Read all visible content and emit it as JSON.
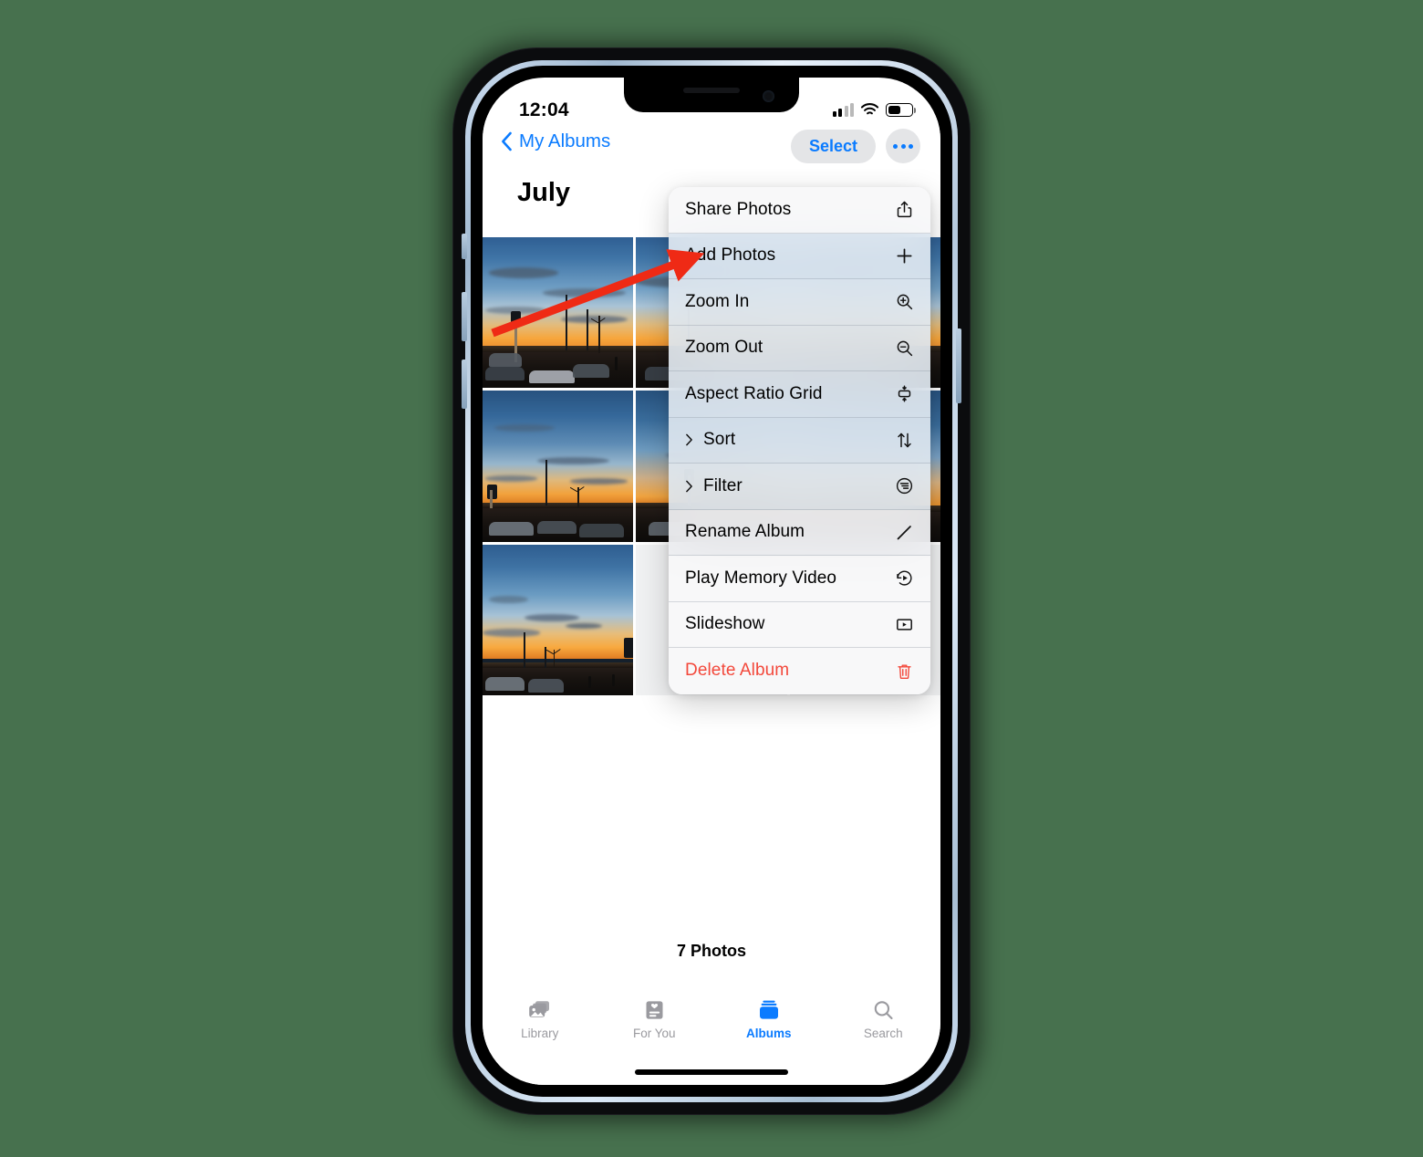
{
  "background_color": "#47714e",
  "accent_color": "#0a7bff",
  "destructive_color": "#f3483b",
  "status_bar": {
    "time": "12:04",
    "cellular_icon": "cellular-signal-icon",
    "wifi_icon": "wifi-icon",
    "battery_icon": "battery-icon"
  },
  "nav_bar": {
    "back_label": "My Albums",
    "back_icon": "chevron-left-icon",
    "select_label": "Select",
    "more_icon": "ellipsis-icon"
  },
  "album": {
    "title": "July",
    "photo_count_label": "7 Photos"
  },
  "context_menu": {
    "items": [
      {
        "label": "Share Photos",
        "icon": "share-icon",
        "submenu": false,
        "destructive": false
      },
      {
        "label": "Add Photos",
        "icon": "plus-icon",
        "submenu": false,
        "destructive": false
      },
      {
        "label": "Zoom In",
        "icon": "magnifier-plus-icon",
        "submenu": false,
        "destructive": false
      },
      {
        "label": "Zoom Out",
        "icon": "magnifier-minus-icon",
        "submenu": false,
        "destructive": false
      },
      {
        "label": "Aspect Ratio Grid",
        "icon": "aspect-ratio-icon",
        "submenu": false,
        "destructive": false
      },
      {
        "label": "Sort",
        "icon": "sort-arrows-icon",
        "submenu": true,
        "destructive": false
      },
      {
        "label": "Filter",
        "icon": "filter-icon",
        "submenu": true,
        "destructive": false
      },
      {
        "label": "Rename Album",
        "icon": "pencil-icon",
        "submenu": false,
        "destructive": false
      },
      {
        "label": "Play Memory Video",
        "icon": "memory-video-icon",
        "submenu": false,
        "destructive": false
      },
      {
        "label": "Slideshow",
        "icon": "slideshow-play-icon",
        "submenu": false,
        "destructive": false
      },
      {
        "label": "Delete Album",
        "icon": "trash-icon",
        "submenu": false,
        "destructive": true
      }
    ]
  },
  "annotation": {
    "type": "arrow",
    "color": "#ef2a15",
    "points_to": "Add Photos"
  },
  "tab_bar": {
    "items": [
      {
        "label": "Library",
        "icon": "photos-library-icon",
        "active": false
      },
      {
        "label": "For You",
        "icon": "for-you-icon",
        "active": false
      },
      {
        "label": "Albums",
        "icon": "albums-icon",
        "active": true
      },
      {
        "label": "Search",
        "icon": "search-icon",
        "active": false
      }
    ]
  }
}
